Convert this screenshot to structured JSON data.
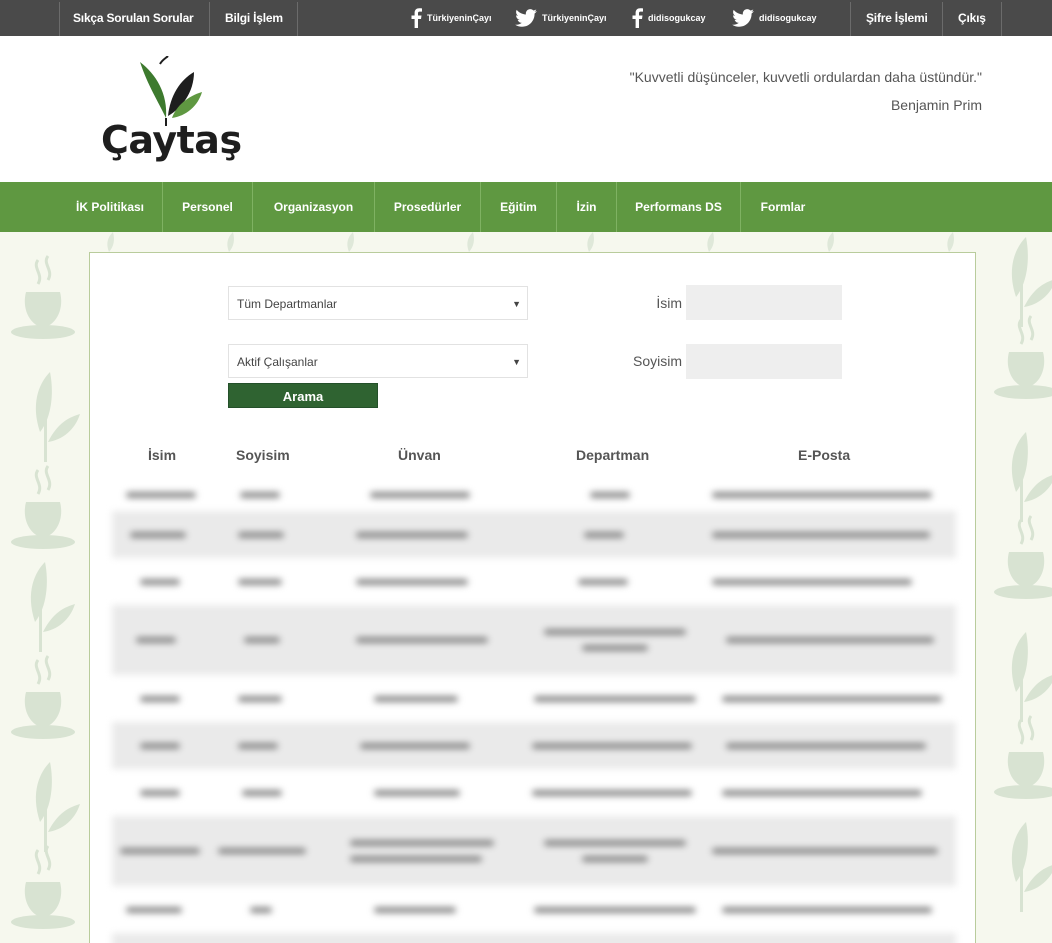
{
  "topbar": {
    "faq": "Sıkça Sorulan Sorular",
    "it": "Bilgi İşlem",
    "socials": [
      {
        "icon": "facebook-icon",
        "label": "TürkiyeninÇayı"
      },
      {
        "icon": "twitter-icon",
        "label": "TürkiyeninÇayı"
      },
      {
        "icon": "facebook-icon",
        "label": "didisogukcay"
      },
      {
        "icon": "twitter-icon",
        "label": "didisogukcay"
      }
    ],
    "password": "Şifre İşlemi",
    "logout": "Çıkış"
  },
  "header": {
    "logo_text": "Çaytaş",
    "quote": "\"Kuvvetli düşünceler, kuvvetli ordulardan daha üstündür.\"",
    "author": "Benjamin Prim"
  },
  "nav": {
    "items": [
      "İK Politikası",
      "Personel",
      "Organizasyon",
      "Prosedürler",
      "Eğitim",
      "İzin",
      "Performans DS",
      "Formlar"
    ]
  },
  "filters": {
    "department": "Tüm Departmanlar",
    "status": "Aktif Çalışanlar",
    "name_label": "İsim",
    "surname_label": "Soyisim",
    "search_button": "Arama"
  },
  "table": {
    "headers": [
      "İsim",
      "Soyisim",
      "Ünvan",
      "Departman",
      "E-Posta"
    ]
  },
  "colors": {
    "topbar": "#4a4a4a",
    "nav": "#5f9841",
    "button": "#2f6331",
    "page_bg": "#f6f8ee"
  }
}
